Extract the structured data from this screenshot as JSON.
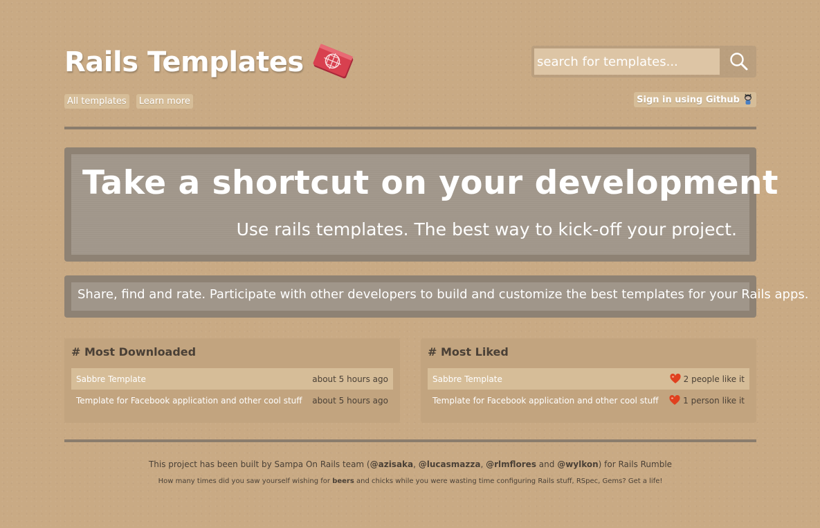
{
  "header": {
    "logo_text": "Rails Templates",
    "search_placeholder": "search for templates...",
    "nav": [
      "All templates",
      "Learn more"
    ],
    "signin_label": "Sign in using Github"
  },
  "hero": {
    "title": "Take a shortcut on your development",
    "subtitle": "Use rails templates. The best way to kick-off your project."
  },
  "tagline": "Share, find and rate. Participate with other developers to build and customize the best templates for your Rails apps.",
  "most_downloaded": {
    "title": "# Most Downloaded",
    "items": [
      {
        "name": "Sabbre Template",
        "meta": "about 5 hours ago"
      },
      {
        "name": "Template for Facebook application and other cool stuff",
        "meta": "about 5 hours ago"
      }
    ]
  },
  "most_liked": {
    "title": "# Most Liked",
    "items": [
      {
        "name": "Sabbre Template",
        "meta": "2 people like it"
      },
      {
        "name": "Template for Facebook application and other cool stuff",
        "meta": "1 person like it"
      }
    ]
  },
  "footer": {
    "line1_prefix": "This project has been built by Sampa On Rails team (",
    "authors": [
      "@azisaka",
      "@lucasmazza",
      "@rlmflores",
      "@wylkon"
    ],
    "sep": ", ",
    "and": " and ",
    "line1_suffix": ") for Rails Rumble",
    "line2_prefix": "How many times did you saw yourself wishing for ",
    "line2_bold": "beers",
    "line2_suffix": " and chicks while you were wasting time configuring Rails stuff, RSpec, Gems? Get a life!"
  },
  "colors": {
    "background": "#c9aa84",
    "panel": "#8e8274",
    "heart": "#e0401f"
  },
  "icons": [
    "book-logo-icon",
    "search-icon",
    "octocat-icon",
    "heart-icon"
  ]
}
